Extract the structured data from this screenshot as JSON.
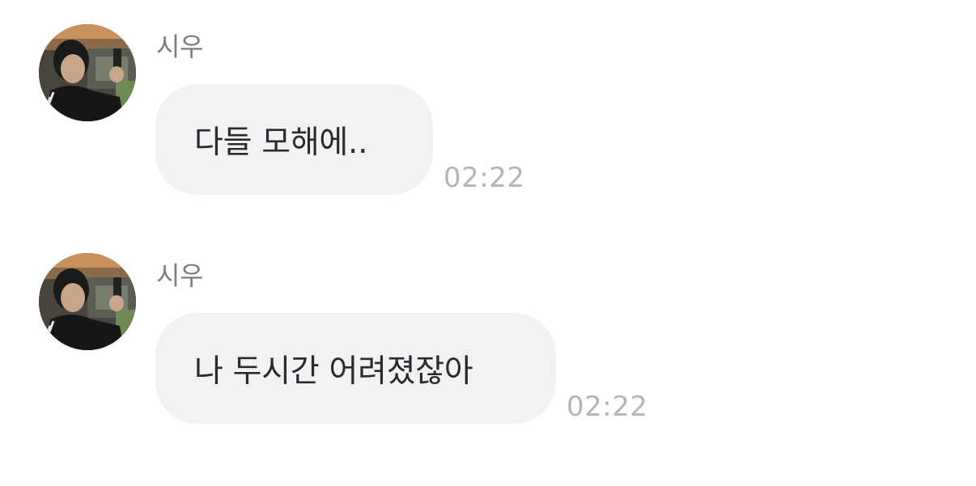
{
  "messages": [
    {
      "sender": "시우",
      "text": "다들 모해에..",
      "time": "02:22"
    },
    {
      "sender": "시우",
      "text": "나 두시간 어려졌잖아",
      "time": "02:22"
    }
  ],
  "colors": {
    "background": "#ffffff",
    "bubble": "#f2f2f5",
    "sender_text": "#7d7d80",
    "time_text": "#b4b4b9",
    "message_text": "#2b2b2e"
  }
}
